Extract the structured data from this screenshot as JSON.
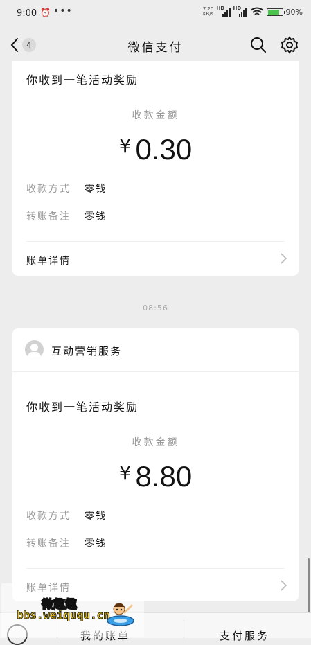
{
  "status_bar": {
    "time": "9:00",
    "speed_top": "7.20",
    "speed_bottom": "KB/s",
    "hd1": "HD",
    "hd2": "HD",
    "battery": "90%"
  },
  "header": {
    "badge": "4",
    "title": "微信支付"
  },
  "cards": [
    {
      "heading": "你收到一笔活动奖励",
      "amount_label": "收款金额",
      "currency": "¥",
      "amount": "0.30",
      "method_label": "收款方式",
      "method_value": "零钱",
      "note_label": "转账备注",
      "note_value": "零钱",
      "details": "账单详情"
    },
    {
      "sender": "互动营销服务",
      "heading": "你收到一笔活动奖励",
      "amount_label": "收款金额",
      "currency": "¥",
      "amount": "8.80",
      "method_label": "收款方式",
      "method_value": "零钱",
      "note_label": "转账备注",
      "note_value": "零钱",
      "details": "账单详情"
    }
  ],
  "timestamp": "08:56",
  "tabbar": {
    "my_bill": "我的账单",
    "services": "支付服务"
  },
  "watermark": {
    "title": "微趣趣",
    "url": "bbs.weiququ.cn"
  },
  "icons": {
    "back": "chevron-left-icon",
    "search": "search-icon",
    "settings": "gear-icon",
    "chevron": "chevron-right-icon"
  }
}
